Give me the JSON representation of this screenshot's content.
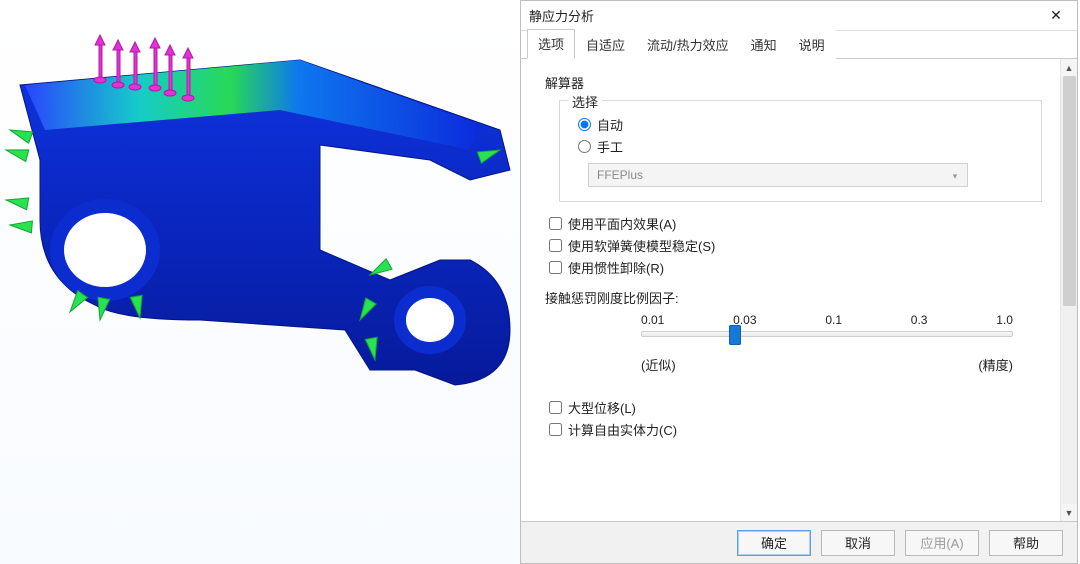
{
  "dialog": {
    "title": "静应力分析",
    "close_glyph": "✕",
    "tabs": [
      "选项",
      "自适应",
      "流动/热力效应",
      "通知",
      "说明"
    ],
    "active_tab_index": 0
  },
  "solver": {
    "group_title": "解算器",
    "choice_legend": "选择",
    "radio_auto": "自动",
    "radio_manual": "手工",
    "selected": "auto",
    "dropdown_value": "FFEPlus"
  },
  "checks": {
    "inplane": "使用平面内效果(A)",
    "softspring": "使用软弹簧使模型稳定(S)",
    "inertia": "使用惯性卸除(R)",
    "inplane_checked": false,
    "softspring_checked": false,
    "inertia_checked": false
  },
  "penalty": {
    "label": "接触惩罚刚度比例因子:",
    "ticks": [
      "0.01",
      "0.03",
      "0.1",
      "0.3",
      "1.0"
    ],
    "value_index": 1,
    "left_label": "(近似)",
    "right_label": "(精度)"
  },
  "checks2": {
    "large_disp": "大型位移(L)",
    "free_body": "计算自由实体力(C)",
    "large_disp_checked": false,
    "free_body_checked": false
  },
  "footer": {
    "ok": "确定",
    "cancel": "取消",
    "apply": "应用(A)",
    "help": "帮助"
  },
  "icons": {
    "chevron_down": "▾",
    "scroll_up": "▲",
    "scroll_down": "▼"
  }
}
